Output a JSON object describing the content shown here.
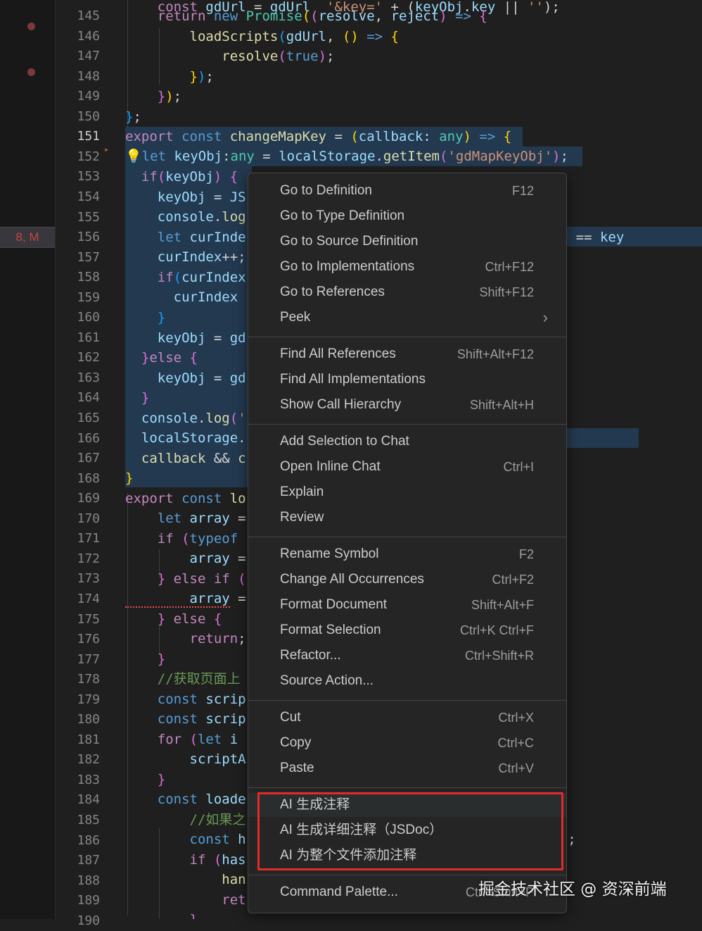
{
  "editor": {
    "active_line": "151",
    "scm_badge": "8, M",
    "line_numbers": [
      "145",
      "146",
      "147",
      "148",
      "149",
      "150",
      "151",
      "152",
      "153",
      "154",
      "155",
      "156",
      "157",
      "158",
      "159",
      "160",
      "161",
      "162",
      "163",
      "164",
      "165",
      "166",
      "167",
      "168",
      "169",
      "170",
      "171",
      "172",
      "173",
      "174",
      "175",
      "176",
      "177",
      "178",
      "179",
      "180",
      "181",
      "182",
      "183",
      "184",
      "185",
      "186",
      "187",
      "188",
      "189",
      "190"
    ]
  },
  "context_menu": {
    "groups": [
      [
        {
          "label": "Go to Definition",
          "shortcut": "F12"
        },
        {
          "label": "Go to Type Definition",
          "shortcut": ""
        },
        {
          "label": "Go to Source Definition",
          "shortcut": ""
        },
        {
          "label": "Go to Implementations",
          "shortcut": "Ctrl+F12"
        },
        {
          "label": "Go to References",
          "shortcut": "Shift+F12"
        },
        {
          "label": "Peek",
          "shortcut": "",
          "submenu": true
        }
      ],
      [
        {
          "label": "Find All References",
          "shortcut": "Shift+Alt+F12"
        },
        {
          "label": "Find All Implementations",
          "shortcut": ""
        },
        {
          "label": "Show Call Hierarchy",
          "shortcut": "Shift+Alt+H"
        }
      ],
      [
        {
          "label": "Add Selection to Chat",
          "shortcut": ""
        },
        {
          "label": "Open Inline Chat",
          "shortcut": "Ctrl+I"
        },
        {
          "label": "Explain",
          "shortcut": ""
        },
        {
          "label": "Review",
          "shortcut": ""
        }
      ],
      [
        {
          "label": "Rename Symbol",
          "shortcut": "F2"
        },
        {
          "label": "Change All Occurrences",
          "shortcut": "Ctrl+F2"
        },
        {
          "label": "Format Document",
          "shortcut": "Shift+Alt+F"
        },
        {
          "label": "Format Selection",
          "shortcut": "Ctrl+K Ctrl+F"
        },
        {
          "label": "Refactor...",
          "shortcut": "Ctrl+Shift+R"
        },
        {
          "label": "Source Action...",
          "shortcut": ""
        }
      ],
      [
        {
          "label": "Cut",
          "shortcut": "Ctrl+X"
        },
        {
          "label": "Copy",
          "shortcut": "Ctrl+C"
        },
        {
          "label": "Paste",
          "shortcut": "Ctrl+V"
        }
      ],
      [
        {
          "label": "AI 生成注释",
          "shortcut": ""
        },
        {
          "label": "AI 生成详细注释（JSDoc）",
          "shortcut": ""
        },
        {
          "label": "AI 为整个文件添加注释",
          "shortcut": ""
        }
      ],
      [
        {
          "label": "Command Palette...",
          "shortcut": "Ctrl+Shift+P"
        }
      ]
    ]
  },
  "watermark": "掘金技术社区 @ 资深前端",
  "colors": {
    "selection": "#264f78",
    "highlight_box": "#e52a2a",
    "menu_bg": "#252526"
  }
}
